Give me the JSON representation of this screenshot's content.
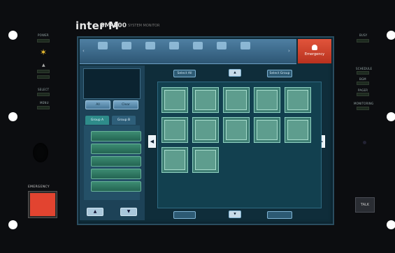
{
  "brand": {
    "name": "inter M",
    "model": "SM-100",
    "subtitle": "SYSTEM MONITOR"
  },
  "left_indicators": [
    "POWER",
    "",
    "SELECT",
    "MENU"
  ],
  "right_indicators": [
    "BUSY",
    "SCHEDULE",
    "BGM",
    "PAGER",
    "MONITORING"
  ],
  "emergency_label": "EMERGENCY",
  "talk_label": "TALK",
  "toolbar": {
    "items": [
      "",
      "",
      "",
      "",
      "",
      "",
      "",
      ""
    ],
    "emergency": "Emergency"
  },
  "left_panel": {
    "buttons": [
      "All",
      "Clear"
    ],
    "tabs": [
      "Group A",
      "Group B"
    ],
    "list": [
      "",
      "",
      "",
      "",
      ""
    ]
  },
  "grid": {
    "top_buttons": [
      "Select All",
      "",
      "Select Group"
    ],
    "bottom_buttons": [
      "",
      "",
      ""
    ],
    "tiles": [
      "",
      "",
      "",
      "",
      "",
      "",
      "",
      "",
      "",
      "",
      "",
      ""
    ]
  },
  "colors": {
    "emergency": "#e24430",
    "toolbar": "#3d6c8e",
    "tile": "#5e9d8e"
  }
}
